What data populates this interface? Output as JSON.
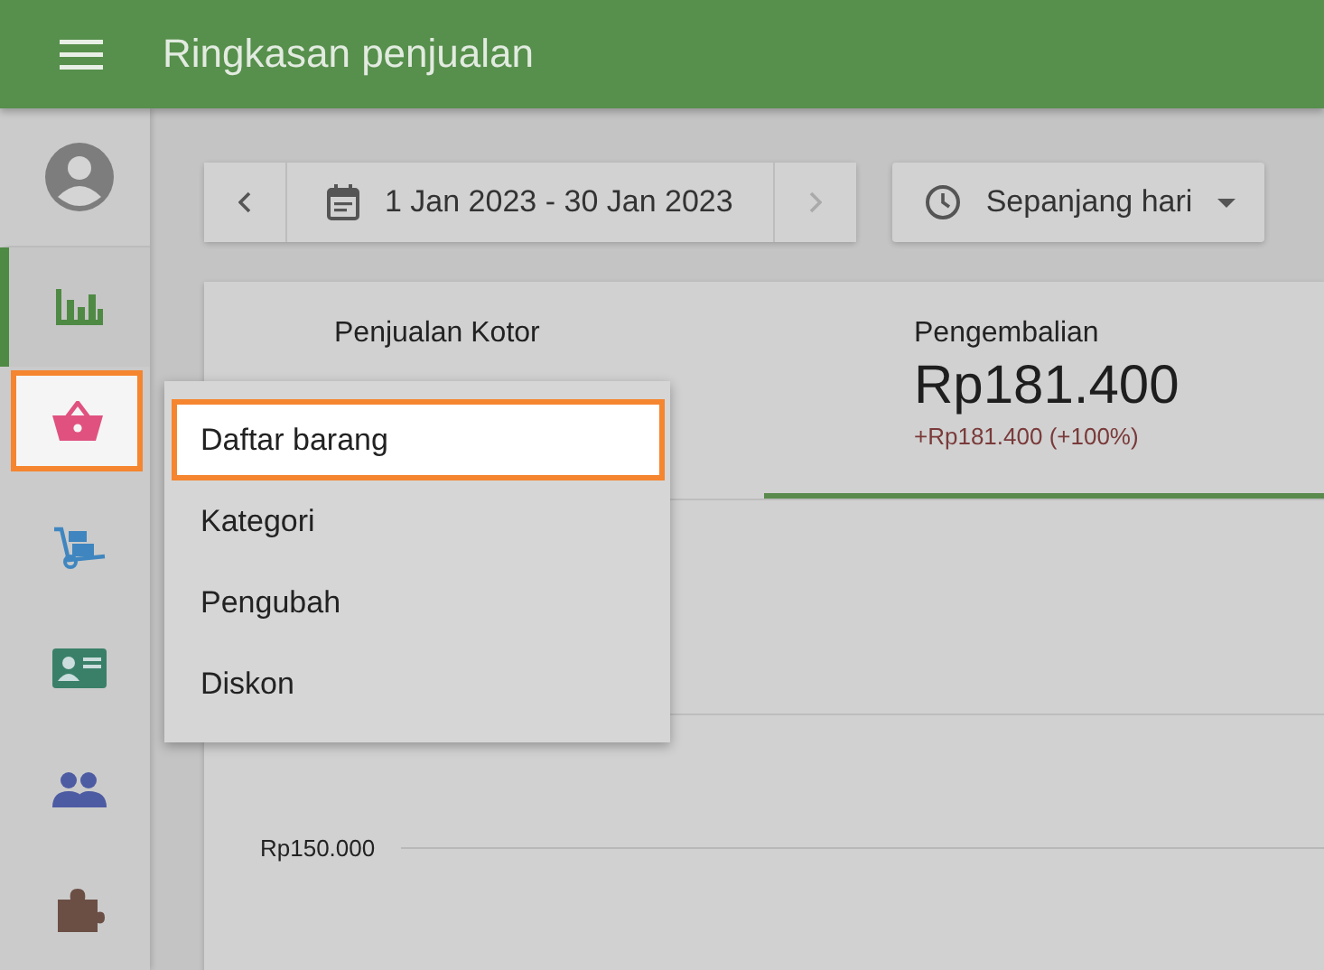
{
  "app_bar": {
    "title": "Ringkasan penjualan"
  },
  "sidebar": {
    "items": [
      {
        "kind": "avatar",
        "selected": false,
        "highlighted": false
      },
      {
        "kind": "chart",
        "selected": true,
        "highlighted": false
      },
      {
        "kind": "basket",
        "selected": false,
        "highlighted": true
      },
      {
        "kind": "cart",
        "selected": false,
        "highlighted": false
      },
      {
        "kind": "card",
        "selected": false,
        "highlighted": false
      },
      {
        "kind": "people",
        "selected": false,
        "highlighted": false
      },
      {
        "kind": "puzzle",
        "selected": false,
        "highlighted": false
      }
    ]
  },
  "date_range": {
    "label": "1 Jan 2023 - 30 Jan 2023",
    "next_disabled": true
  },
  "time_filter": {
    "label": "Sepanjang hari"
  },
  "summary": {
    "tabs": [
      {
        "label": "Penjualan Kotor",
        "selected": false
      },
      {
        "label": "Pengembalian",
        "value": "Rp181.400",
        "change": "+Rp181.400 (+100%)",
        "selected": true
      }
    ]
  },
  "chart": {
    "y_tick_label": "Rp150.000"
  },
  "menu": {
    "items": [
      {
        "label": "Daftar barang",
        "selected": true
      },
      {
        "label": "Kategori",
        "selected": false
      },
      {
        "label": "Pengubah",
        "selected": false
      },
      {
        "label": "Diskon",
        "selected": false
      }
    ]
  }
}
